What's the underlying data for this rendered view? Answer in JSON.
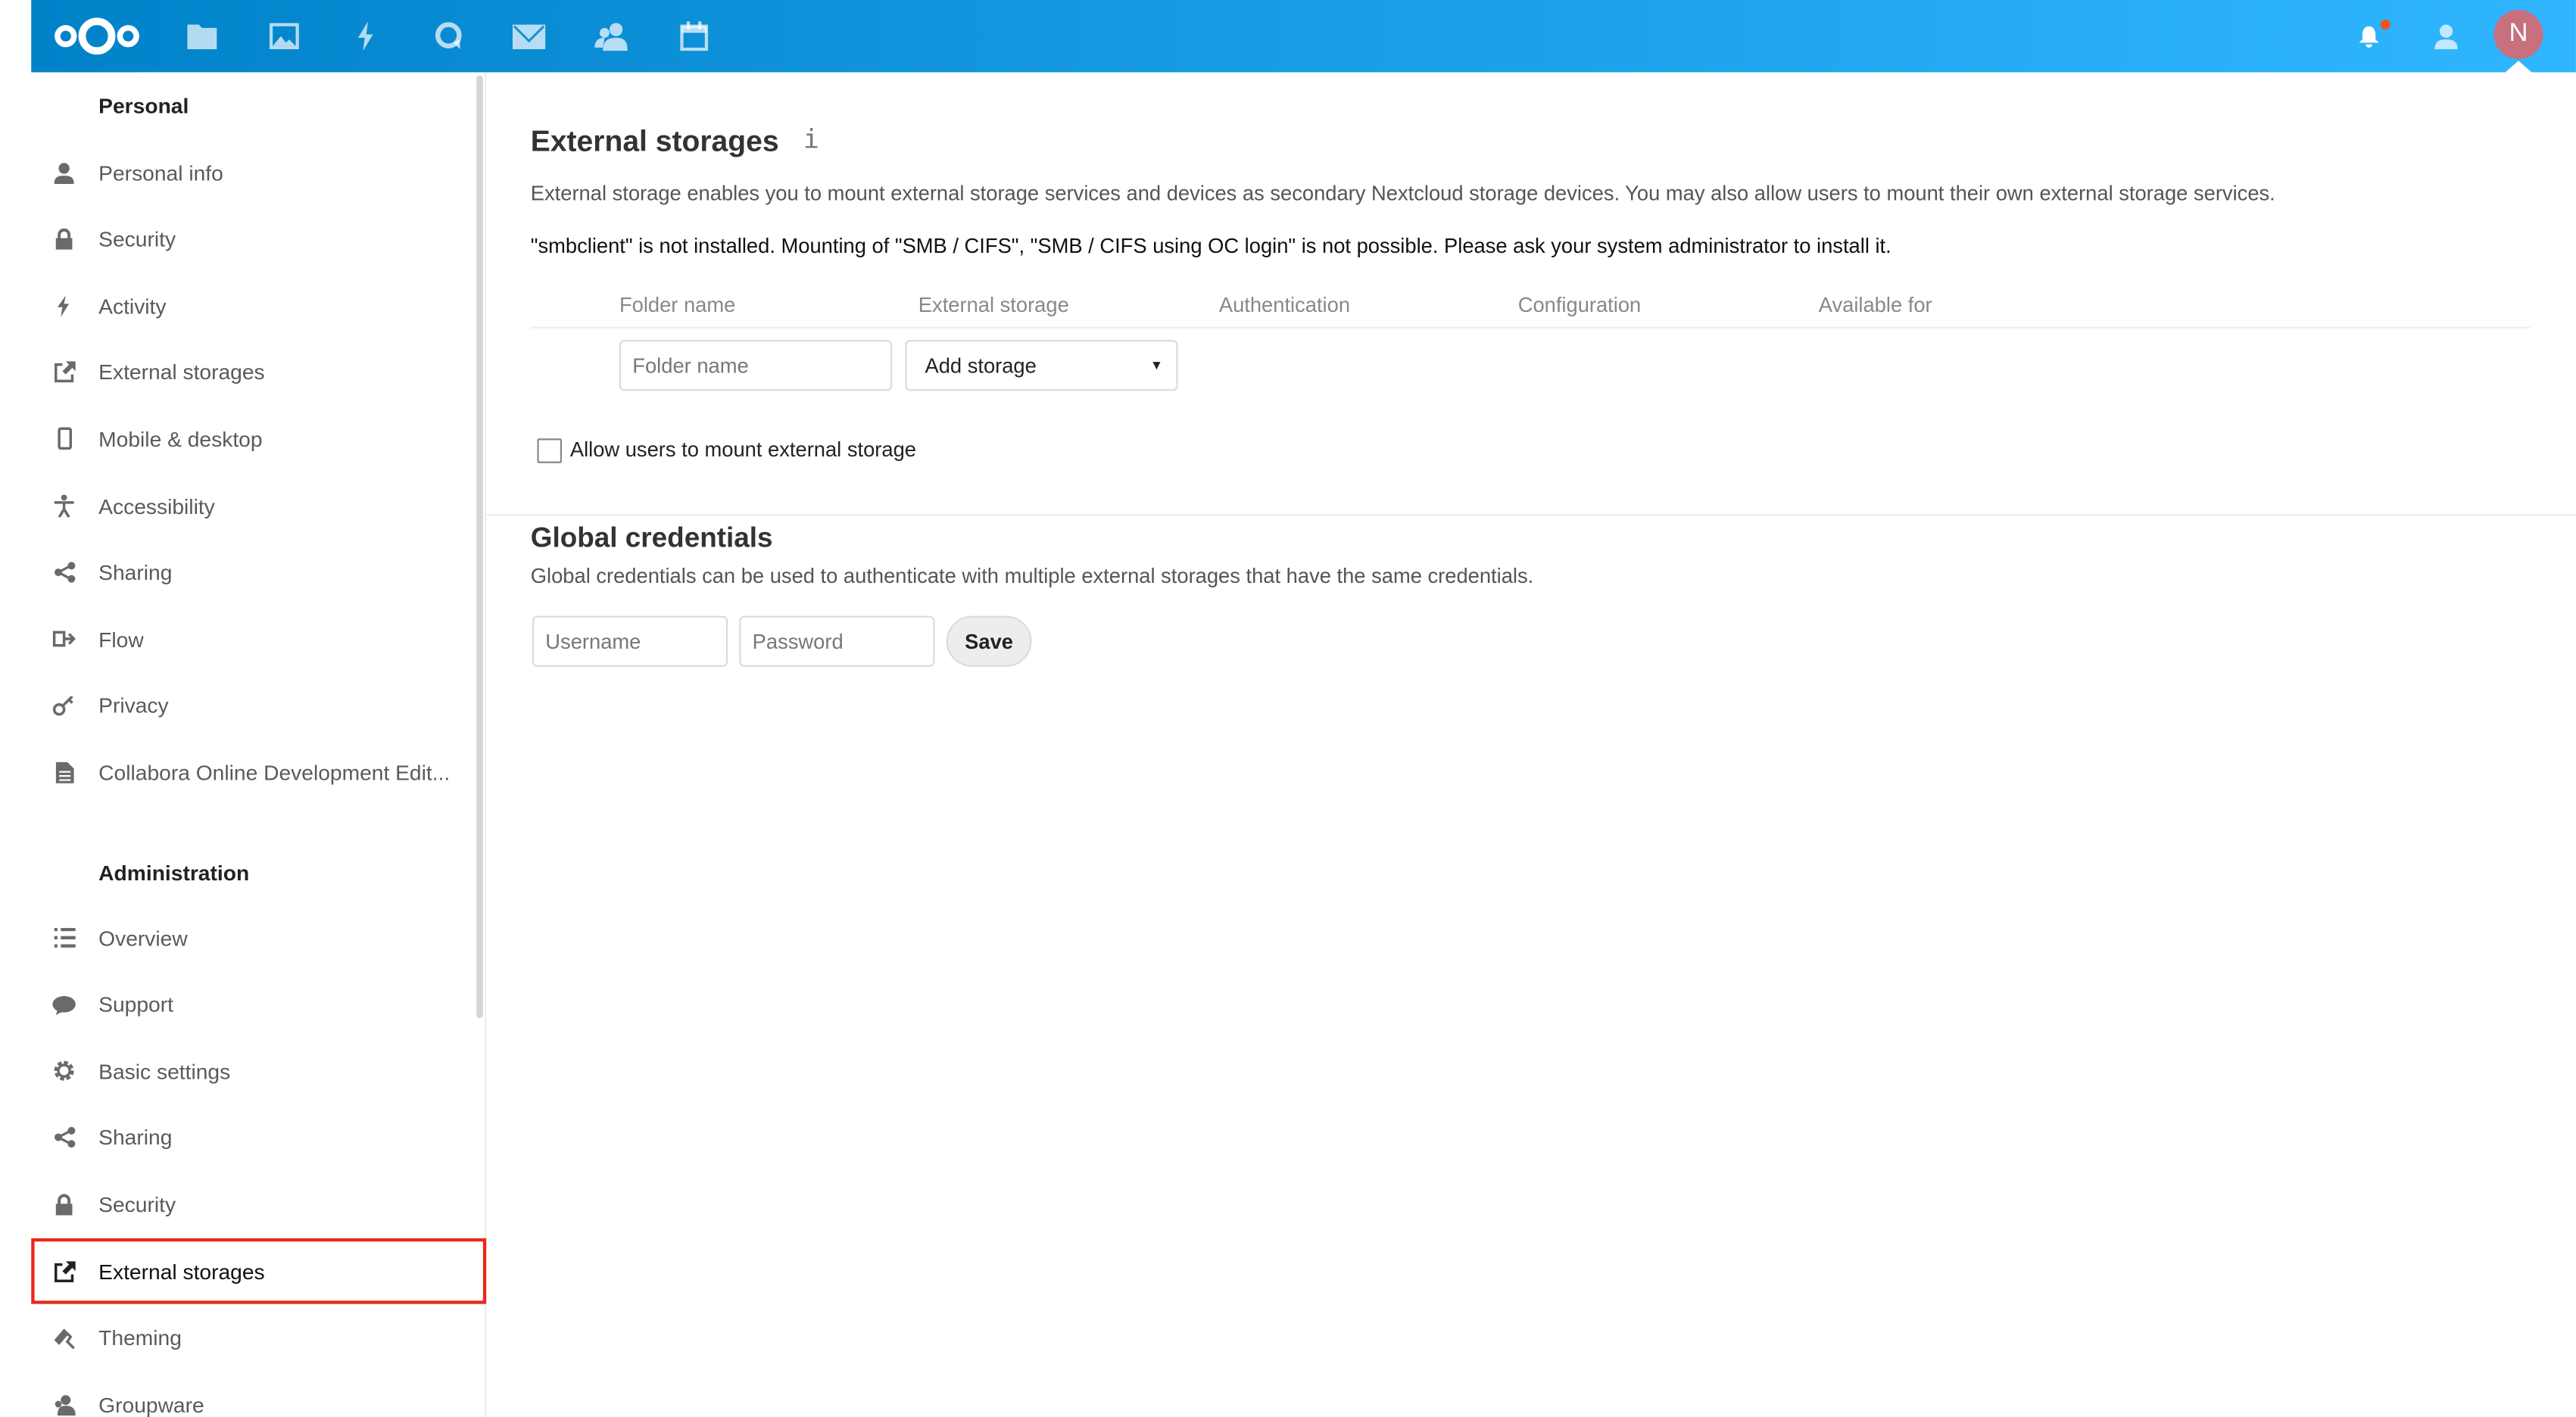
{
  "colors": {
    "header_start": "#0082c9",
    "header_end": "#30b6ff",
    "highlight": "#e8291b",
    "avatar": "#c8707e"
  },
  "header": {
    "apps": [
      "files-icon",
      "photos-icon",
      "activity-icon",
      "talk-icon",
      "mail-icon",
      "contacts-icon",
      "calendar-icon"
    ],
    "avatar_letter": "N"
  },
  "sidebar": {
    "personal_heading": "Personal",
    "personal": [
      {
        "label": "Personal info",
        "icon": "user-icon"
      },
      {
        "label": "Security",
        "icon": "lock-icon"
      },
      {
        "label": "Activity",
        "icon": "activity-icon"
      },
      {
        "label": "External storages",
        "icon": "external-link-icon"
      },
      {
        "label": "Mobile & desktop",
        "icon": "phone-icon"
      },
      {
        "label": "Accessibility",
        "icon": "accessibility-icon"
      },
      {
        "label": "Sharing",
        "icon": "share-icon"
      },
      {
        "label": "Flow",
        "icon": "flow-icon"
      },
      {
        "label": "Privacy",
        "icon": "key-icon"
      },
      {
        "label": "Collabora Online Development Edit...",
        "icon": "document-icon"
      }
    ],
    "admin_heading": "Administration",
    "admin": [
      {
        "label": "Overview",
        "icon": "list-icon"
      },
      {
        "label": "Support",
        "icon": "chat-icon"
      },
      {
        "label": "Basic settings",
        "icon": "gear-icon"
      },
      {
        "label": "Sharing",
        "icon": "share-icon"
      },
      {
        "label": "Security",
        "icon": "lock-icon"
      },
      {
        "label": "External storages",
        "icon": "external-link-icon",
        "active": true
      },
      {
        "label": "Theming",
        "icon": "paint-roller-icon"
      },
      {
        "label": "Groupware",
        "icon": "group-icon"
      }
    ]
  },
  "main": {
    "title": "External storages",
    "info_glyph": "i",
    "description": "External storage enables you to mount external storage services and devices as secondary Nextcloud storage devices. You may also allow users to mount their own external storage services.",
    "warning": "\"smbclient\" is not installed. Mounting of \"SMB / CIFS\", \"SMB / CIFS using OC login\" is not possible. Please ask your system administrator to install it.",
    "columns": [
      "Folder name",
      "External storage",
      "Authentication",
      "Configuration",
      "Available for"
    ],
    "folder_placeholder": "Folder name",
    "add_storage": "Add storage",
    "allow_users_label": "Allow users to mount external storage",
    "allow_users_checked": false,
    "global_title": "Global credentials",
    "global_description": "Global credentials can be used to authenticate with multiple external storages that have the same credentials.",
    "username_placeholder": "Username",
    "password_placeholder": "Password",
    "save_label": "Save"
  }
}
